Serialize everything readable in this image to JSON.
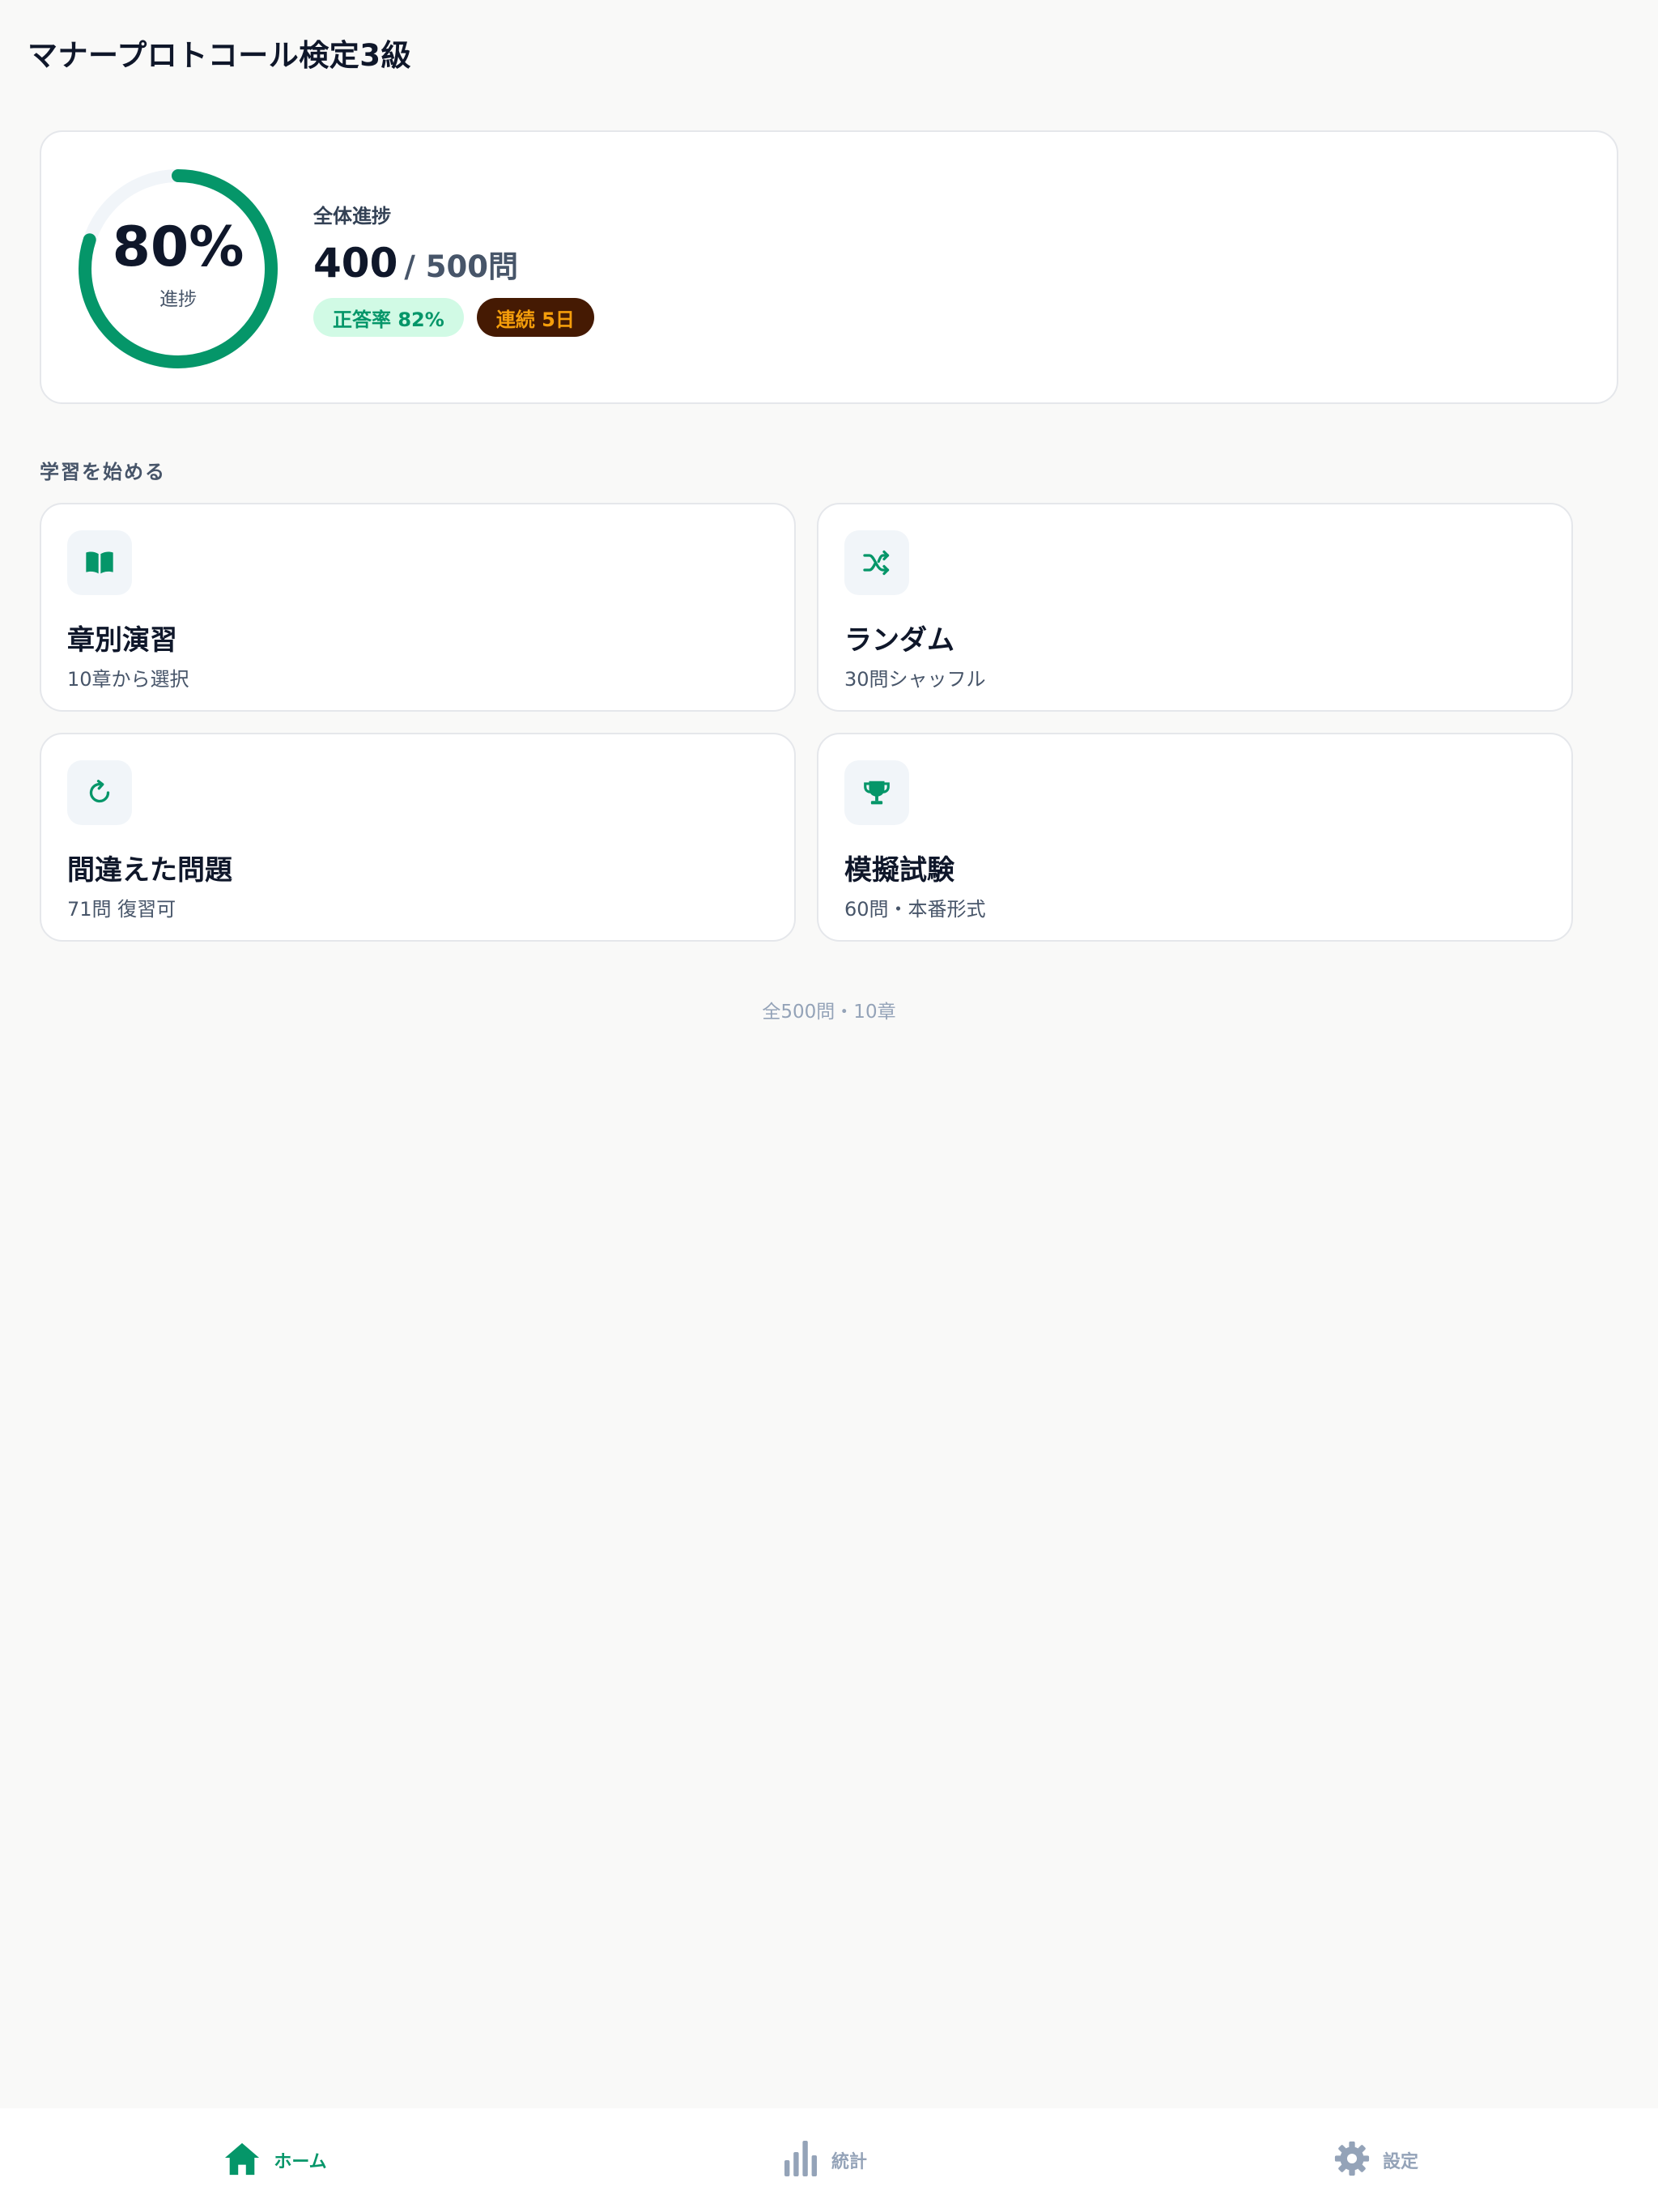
{
  "app": {
    "title": "マナープロトコール検定3級"
  },
  "progress": {
    "percent_text": "80%",
    "ring_label": "進捗",
    "ring_fraction": 0.8,
    "label": "全体進捗",
    "done": "400",
    "total": "/ 500問",
    "accuracy_badge": "正答率 82%",
    "streak_badge": "連続 5日"
  },
  "section": {
    "heading": "学習を始める"
  },
  "modes": [
    {
      "title": "章別演習",
      "subtitle": "10章から選択",
      "icon": "book-open-icon"
    },
    {
      "title": "ランダム",
      "subtitle": "30問シャッフル",
      "icon": "shuffle-icon"
    },
    {
      "title": "間違えた問題",
      "subtitle": "71問 復習可",
      "icon": "refresh-icon"
    },
    {
      "title": "模擬試験",
      "subtitle": "60問・本番形式",
      "icon": "trophy-icon"
    }
  ],
  "footer": {
    "note": "全500問・10章"
  },
  "tabs": [
    {
      "label": "ホーム",
      "icon": "home-icon",
      "active": true
    },
    {
      "label": "統計",
      "icon": "bar-chart-icon",
      "active": false
    },
    {
      "label": "設定",
      "icon": "gear-icon",
      "active": false
    }
  ],
  "colors": {
    "accent": "#059669",
    "ring_track": "#f1f5f9",
    "background": "#f9f9f8",
    "inactive_tab": "#94a3b8",
    "streak_bg": "#451a03",
    "streak_fg": "#f59e0b"
  }
}
